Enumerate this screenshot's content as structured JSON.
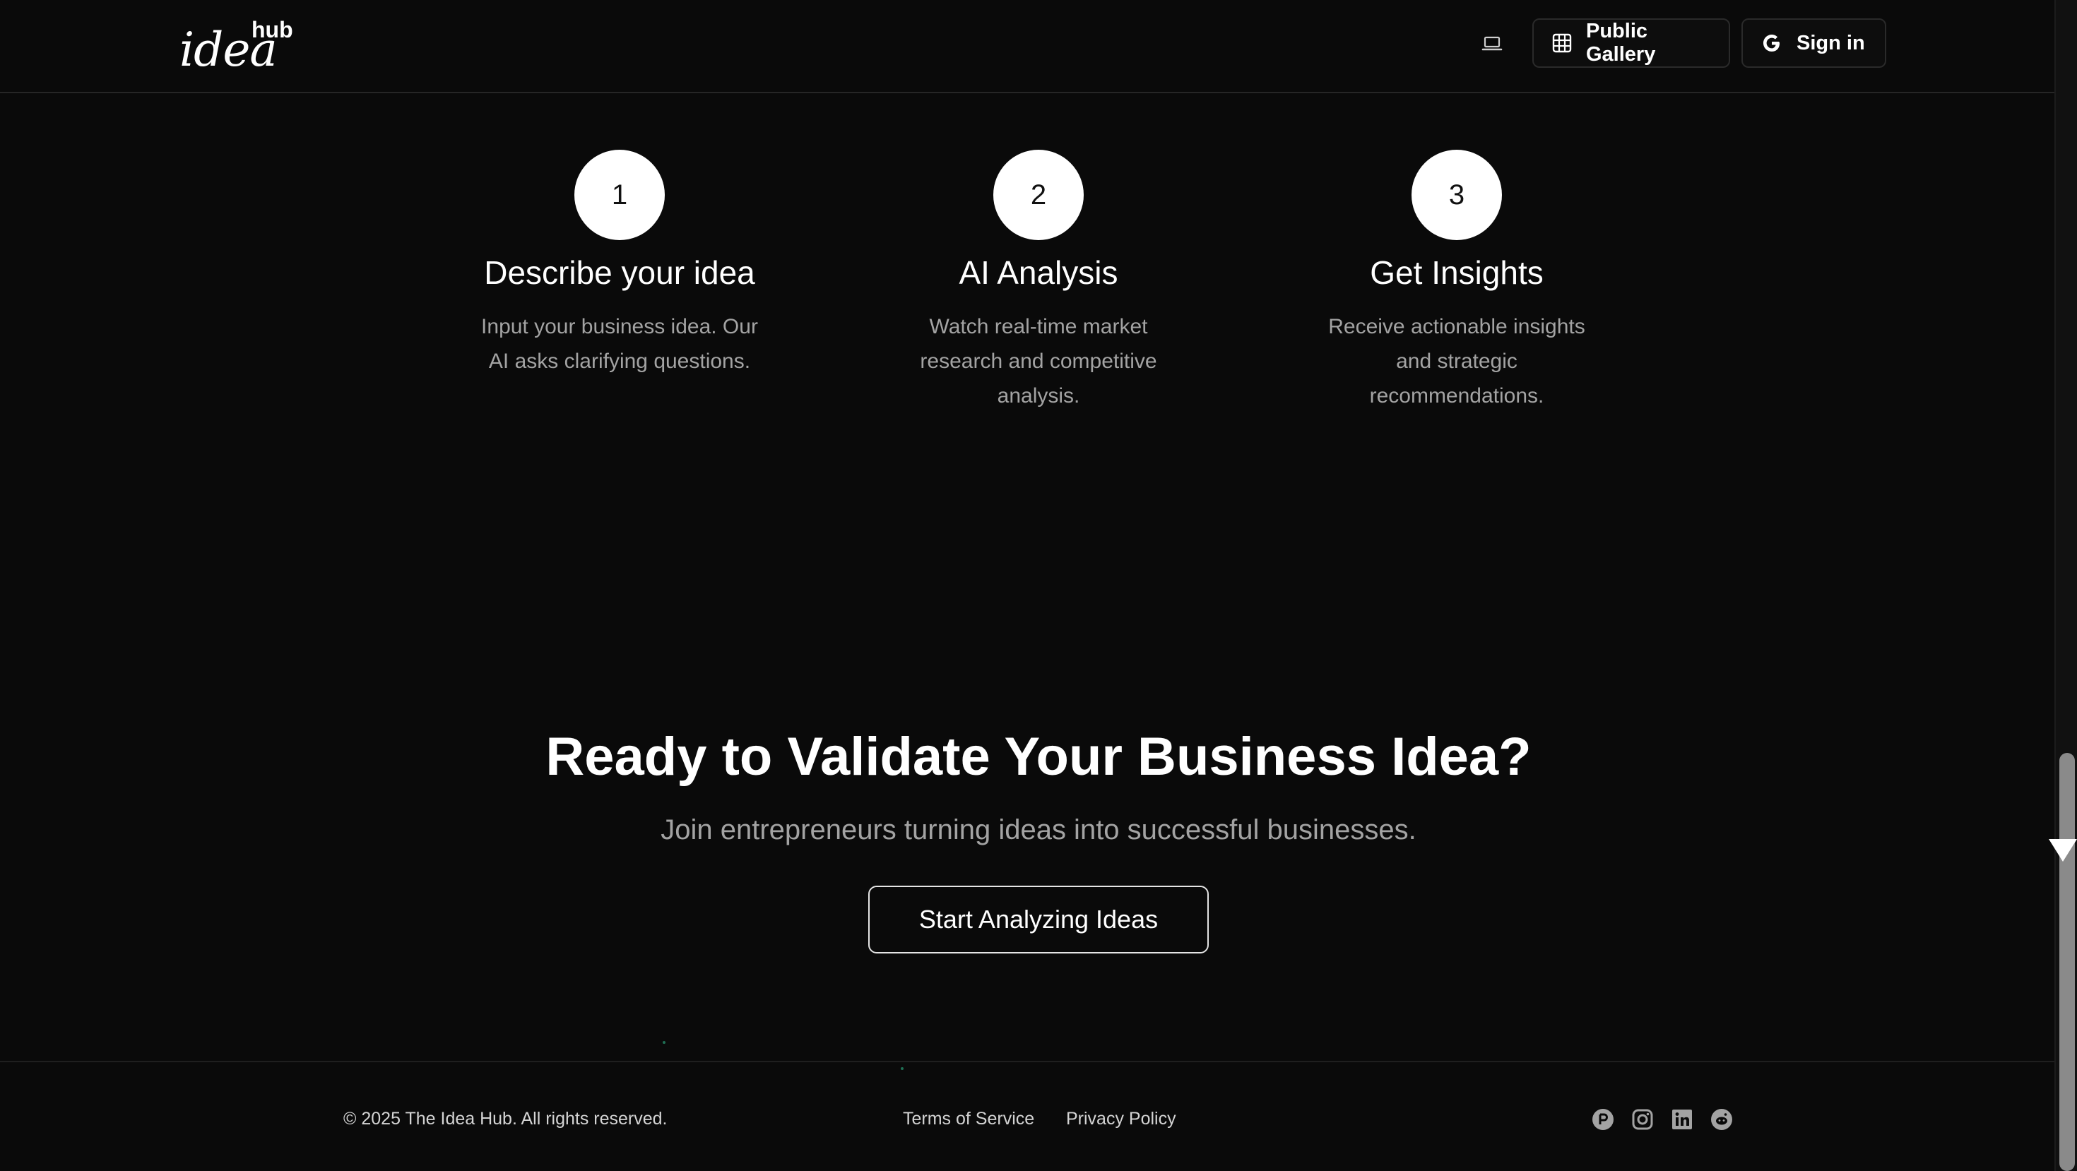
{
  "header": {
    "logo_main": "idea",
    "logo_sup": "hub",
    "theme_icon": "laptop-icon",
    "gallery_label": "Public Gallery",
    "gallery_icon": "grid-icon",
    "signin_label": "Sign in",
    "signin_icon": "google-icon"
  },
  "steps": [
    {
      "number": "1",
      "title": "Describe your idea",
      "description": "Input your business idea. Our AI asks clarifying questions."
    },
    {
      "number": "2",
      "title": "AI Analysis",
      "description": "Watch real-time market research and competitive analysis."
    },
    {
      "number": "3",
      "title": "Get Insights",
      "description": "Receive actionable insights and strategic recommendations."
    }
  ],
  "cta": {
    "title": "Ready to Validate Your Business Idea?",
    "subtitle": "Join entrepreneurs turning ideas into successful businesses.",
    "button_label": "Start Analyzing Ideas"
  },
  "footer": {
    "copyright": "© 2025 The Idea Hub. All rights reserved.",
    "terms_label": "Terms of Service",
    "privacy_label": "Privacy Policy",
    "social_icons": [
      "producthunt-icon",
      "instagram-icon",
      "linkedin-icon",
      "reddit-icon"
    ]
  },
  "colors": {
    "background": "#0a0a0a",
    "text_primary": "#ffffff",
    "text_muted": "#a3a3a3",
    "border": "#262626"
  }
}
